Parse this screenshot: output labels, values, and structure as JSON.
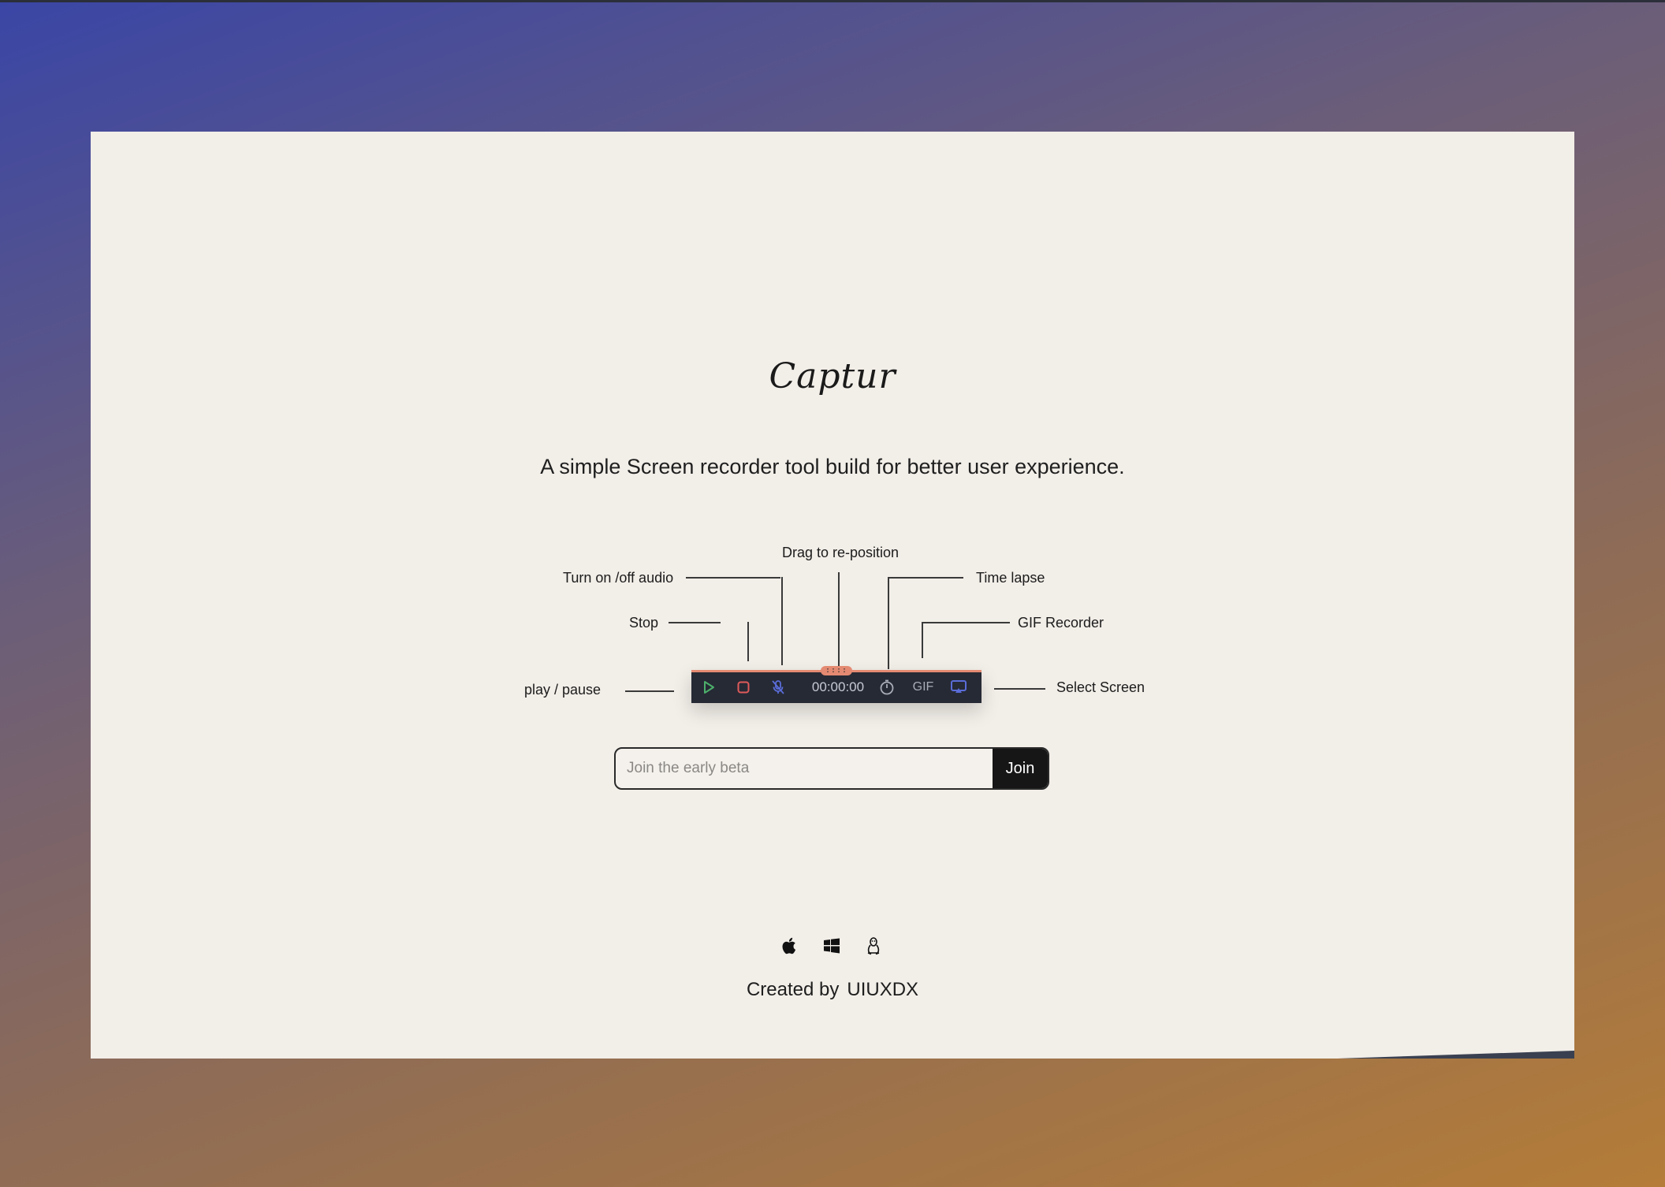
{
  "brand": {
    "logo_text": "Captur"
  },
  "tagline": "A simple Screen recorder tool build for better user experience.",
  "annotations": {
    "drag": "Drag to re-position",
    "audio": "Turn on /off audio",
    "timelapse": "Time lapse",
    "stop": "Stop",
    "gif_recorder": "GIF Recorder",
    "play_pause": "play / pause",
    "select_screen": "Select Screen"
  },
  "toolbar": {
    "timer": "00:00:00",
    "gif_label": "GIF",
    "drag_glyph": "::::",
    "colors": {
      "play": "#4caf6a",
      "stop": "#e05a5a",
      "mic": "#5a6cd8",
      "screen": "#5a6cd8",
      "accent": "#e48a72",
      "background": "#262a35"
    },
    "icons": [
      "play-icon",
      "stop-icon",
      "microphone-off-icon",
      "timer-icon",
      "gif-icon",
      "screen-select-icon"
    ]
  },
  "signup": {
    "placeholder": "Join the early beta",
    "button_label": "Join"
  },
  "platforms": [
    "apple-icon",
    "windows-icon",
    "linux-icon"
  ],
  "credit": {
    "prefix": "Created by",
    "author": "UIUXDX"
  }
}
